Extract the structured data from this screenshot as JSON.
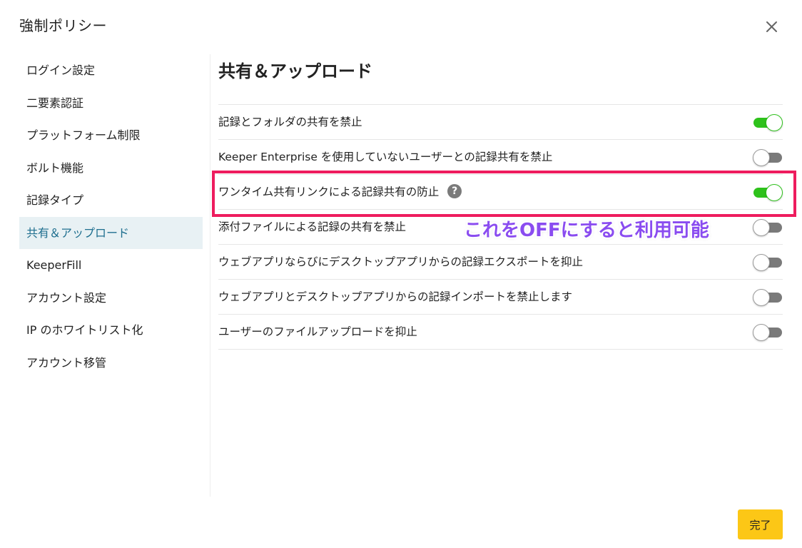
{
  "dialog": {
    "title": "強制ポリシー",
    "close_icon": "close-icon"
  },
  "sidebar": {
    "active_index": 5,
    "items": [
      {
        "label": "ログイン設定"
      },
      {
        "label": "二要素認証"
      },
      {
        "label": "プラットフォーム制限"
      },
      {
        "label": "ボルト機能"
      },
      {
        "label": "記録タイプ"
      },
      {
        "label": "共有＆アップロード"
      },
      {
        "label": "KeeperFill"
      },
      {
        "label": "アカウント設定"
      },
      {
        "label": "IP のホワイトリスト化"
      },
      {
        "label": "アカウント移管"
      }
    ]
  },
  "main": {
    "section_title": "共有＆アップロード",
    "settings": [
      {
        "label": "記録とフォルダの共有を禁止",
        "enabled": true
      },
      {
        "label": "Keeper Enterprise を使用していないユーザーとの記録共有を禁止",
        "enabled": false
      },
      {
        "label": "ワンタイム共有リンクによる記録共有の防止",
        "enabled": true,
        "help_icon": "?"
      },
      {
        "label": "添付ファイルによる記録の共有を禁止",
        "enabled": false
      },
      {
        "label": "ウェブアプリならびにデスクトップアプリからの記録エクスポートを抑止",
        "enabled": false
      },
      {
        "label": "ウェブアプリとデスクトップアプリからの記録インポートを禁止します",
        "enabled": false
      },
      {
        "label": "ユーザーのファイルアップロードを抑止",
        "enabled": false
      }
    ]
  },
  "annotation": {
    "text": "これをOFFにすると利用可能",
    "text_color": "#8a4cf0",
    "box_color": "#ee1c5e"
  },
  "footer": {
    "done_label": "完了",
    "done_color": "#fcc716"
  },
  "colors": {
    "toggle_on": "#2ec21b",
    "toggle_off": "#7a7a7a",
    "active_sidebar_bg": "#e8f1f4",
    "active_sidebar_text": "#1f6f8f"
  }
}
